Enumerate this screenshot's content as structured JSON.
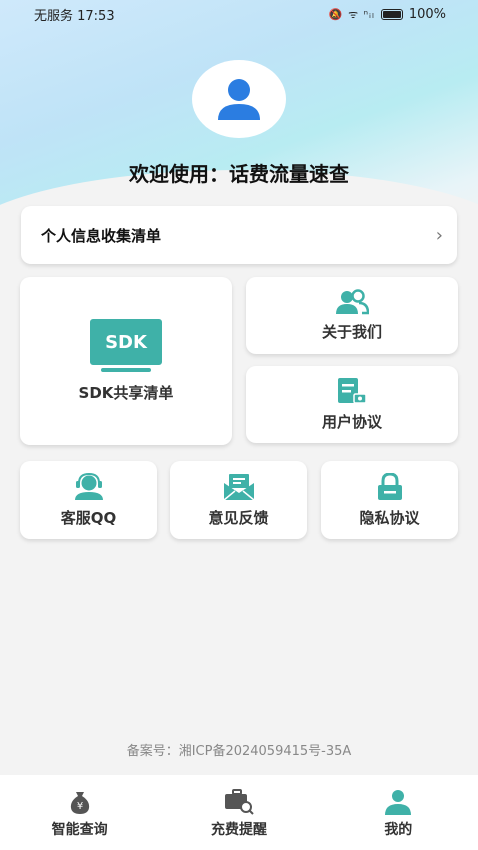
{
  "status_bar": {
    "carrier_time": "无服务 17:53",
    "signal_icons": "🔕 ᯤ ⁿᵢₗ",
    "battery": "100%"
  },
  "header": {
    "welcome": "欢迎使用：话费流量速查",
    "avatar_icon": "user-icon"
  },
  "menu": {
    "info_list": "个人信息收集清单",
    "sdk_icon_text": "SDK",
    "sdk_list": "SDK共享清单",
    "about": "关于我们",
    "agreement": "用户协议",
    "customer_qq": "客服QQ",
    "feedback": "意见反馈",
    "privacy": "隐私协议"
  },
  "footer": {
    "icp": "备案号：湘ICP备2024059415号-35A"
  },
  "tabbar": {
    "tabs": [
      {
        "label": "智能查询",
        "icon": "money-bag-icon"
      },
      {
        "label": "充费提醒",
        "icon": "wallet-search-icon"
      },
      {
        "label": "我的",
        "icon": "user-icon"
      }
    ]
  },
  "colors": {
    "accent_teal": "#3fb1a8",
    "avatar_blue": "#2b7de1"
  }
}
